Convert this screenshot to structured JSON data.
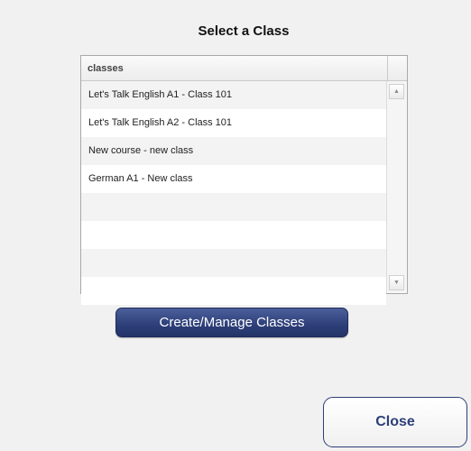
{
  "dialog": {
    "title": "Select a Class"
  },
  "grid": {
    "column_header": "classes",
    "rows": [
      "Let's Talk English A1 - Class 101",
      "Let's Talk English A2 - Class 101",
      "New course - new class",
      "German A1 - New class",
      "",
      "",
      "",
      ""
    ]
  },
  "buttons": {
    "manage_label": "Create/Manage Classes",
    "close_label": "Close"
  },
  "colors": {
    "primary": "#2d3f78",
    "background": "#f1f1f1"
  },
  "icons": {
    "scroll_up": "triangle-up-icon",
    "scroll_down": "triangle-down-icon"
  }
}
